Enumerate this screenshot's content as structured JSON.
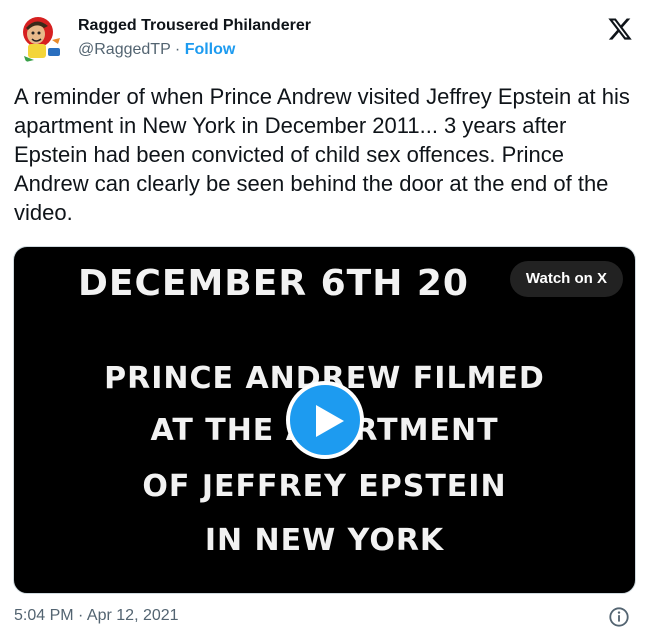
{
  "author": {
    "display_name": "Ragged Trousered Philanderer",
    "handle": "@RaggedTP",
    "separator": "·",
    "follow_label": "Follow"
  },
  "tweet": {
    "text": "A reminder of when Prince Andrew visited Jeffrey Epstein at his apartment in New York in December 2011... 3 years after Epstein had been convicted of child sex offences. Prince Andrew can clearly be seen behind the door at the end of the video."
  },
  "video": {
    "line1": "DECEMBER 6TH 20",
    "line2": "PRINCE ANDREW FILMED",
    "line3": "AT THE APARTMENT",
    "line4": "OF JEFFREY EPSTEIN",
    "line5": "IN NEW YORK",
    "watch_label": "Watch on X",
    "play_icon": "play-icon"
  },
  "footer": {
    "timestamp": "5:04 PM · Apr 12, 2021",
    "info_icon": "info-icon"
  },
  "colors": {
    "accent": "#1d9bf0",
    "text": "#0f1419",
    "muted": "#536471",
    "video_bg": "#000000"
  }
}
